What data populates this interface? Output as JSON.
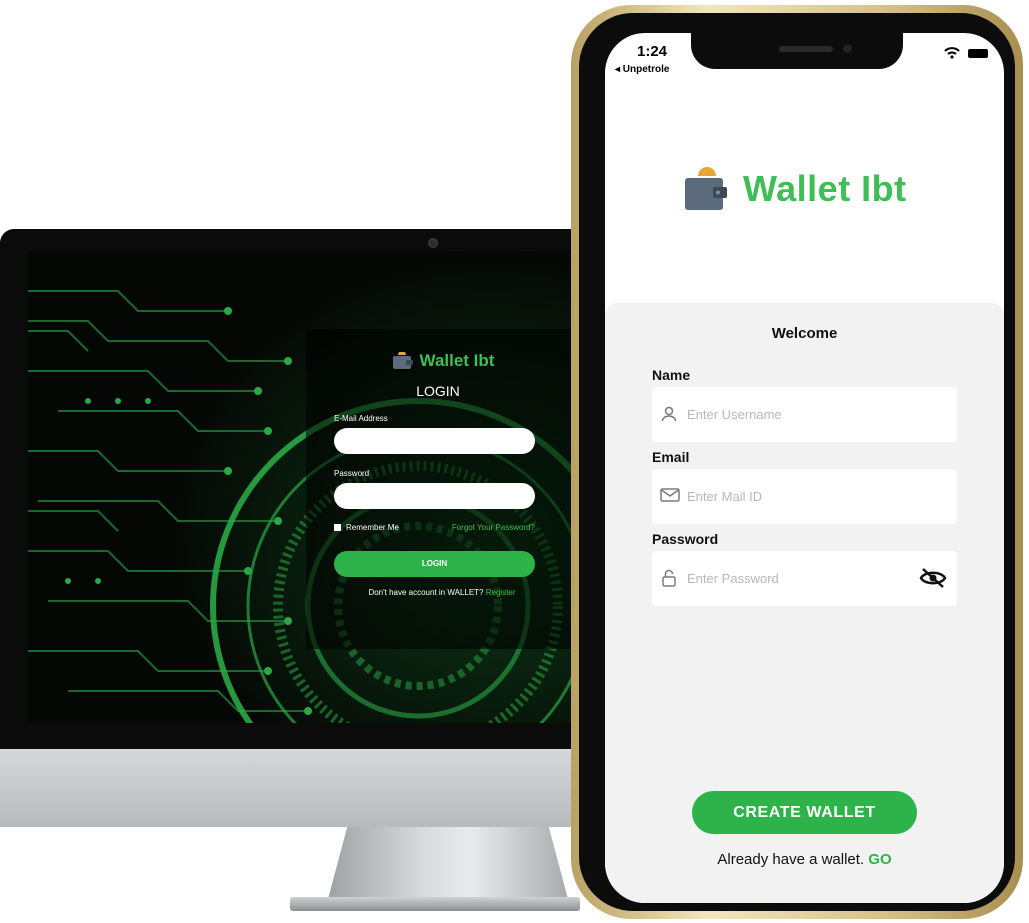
{
  "desktop": {
    "brand": "Wallet Ibt",
    "title": "LOGIN",
    "email_label": "E-Mail Address",
    "password_label": "Password",
    "remember_label": "Remember Me",
    "forgot_link": "Forgot Your Password?",
    "login_button": "LOGIN",
    "register_prompt": "Don't have account in WALLET?",
    "register_link": "Register"
  },
  "phone": {
    "status_time": "1:24",
    "back_label": "◂ Unpetrole",
    "brand": "Wallet Ibt",
    "welcome": "Welcome",
    "name_label": "Name",
    "name_placeholder": "Enter Username",
    "email_label": "Email",
    "email_placeholder": "Enter Mail ID",
    "password_label": "Password",
    "password_placeholder": "Enter Password",
    "create_button": "CREATE WALLET",
    "already_text": "Already have a wallet.",
    "go_link": "GO"
  },
  "icons": [
    "wallet-icon",
    "user-icon",
    "mail-icon",
    "lock-icon",
    "eye-off-icon",
    "wifi-icon",
    "battery-icon"
  ],
  "colors": {
    "brand_green": "#3fbe55",
    "button_green": "#2eb34a",
    "circuit_green": "#1f7a36",
    "sheet_bg": "#f2f2f2"
  }
}
